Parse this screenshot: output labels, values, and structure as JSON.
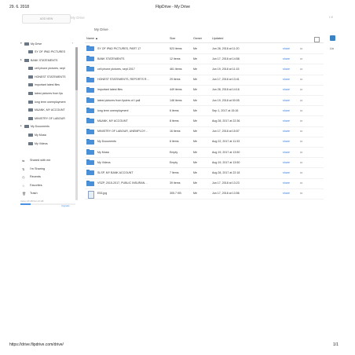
{
  "print_header": {
    "date": "29. 6. 2018",
    "title": "FlipDrive - My Drive"
  },
  "print_footer": {
    "url": "https://drive.flipdrive.com/drive/",
    "page": "1/1"
  },
  "topbar": {
    "new_label": "ADD NEW",
    "faint_title": "My Drive",
    "menu_faint": "Ⅱ  Ⅲ",
    "breadcrumb": "My Drive"
  },
  "right_partial": {
    "label": "Uo"
  },
  "sidebar": {
    "root": "My Drive",
    "items": [
      {
        "label": "SY OF IPAD PICTURES",
        "indent": 1
      },
      {
        "label": "BANK STATEMENTS",
        "indent": 0
      },
      {
        "label": "cell phone pictures, sept",
        "indent": 1
      },
      {
        "label": "HONEST STATEMENTS",
        "indent": 1
      },
      {
        "label": "important latest files",
        "indent": 1
      },
      {
        "label": "latest pictures from fys",
        "indent": 1
      },
      {
        "label": "long term unemployment",
        "indent": 1
      },
      {
        "label": "M&ANK, MY ACCOUNT",
        "indent": 1
      },
      {
        "label": "MINISTRY OF LABOUR",
        "indent": 1
      },
      {
        "label": "My Documents",
        "indent": 0
      },
      {
        "label": "My Music",
        "indent": 1
      },
      {
        "label": "My Videos",
        "indent": 1
      }
    ],
    "nav": [
      {
        "icon": "⇆",
        "label": "Shared with me"
      },
      {
        "icon": "⇅",
        "label": "I'm Sharing"
      },
      {
        "icon": "◷",
        "label": "Recents"
      },
      {
        "icon": "☆",
        "label": "Favorites"
      },
      {
        "icon": "🗑",
        "label": "Trash"
      }
    ],
    "usage_text": "Using 1.8 GB from 10 GB",
    "usage_fraction": 0.18,
    "upgrade_label": "Upgrade"
  },
  "table": {
    "headers": {
      "name": "Name ▲",
      "size": "Size",
      "owner": "Owner",
      "updated": "Updated"
    },
    "rows": [
      {
        "name": "SY OF IPAD PICTURES, PART 17",
        "size": "523 items",
        "owner": "Me",
        "updated": "Jun 28, 2018 at 11:20",
        "share": "share",
        "more": "•••"
      },
      {
        "name": "BANK STATEMENTS",
        "size": "12 items",
        "owner": "Me",
        "updated": "Jun 17, 2018 at 14:58",
        "share": "share",
        "more": "•••"
      },
      {
        "name": "cell phone pictures, sept 2017",
        "size": "461 items",
        "owner": "Me",
        "updated": "Jun 19, 2018 at 11:15",
        "share": "share",
        "more": "•••"
      },
      {
        "name": "HONEST STATEMENTS, REPORTS R…",
        "size": "29 items",
        "owner": "Me",
        "updated": "Jun 17, 2018 at 13:41",
        "share": "share",
        "more": "•••"
      },
      {
        "name": "important latest files",
        "size": "449 items",
        "owner": "Me",
        "updated": "Jun 28, 2018 at 14:16",
        "share": "share",
        "more": "•••"
      },
      {
        "name": "latest pictures from fysiers of I pall",
        "size": "146 items",
        "owner": "Me",
        "updated": "Jun 19, 2018 at 00:05",
        "share": "share",
        "more": "•••"
      },
      {
        "name": "long term unemployment",
        "size": "6 items",
        "owner": "Me",
        "updated": "Sep 1, 2017 at 15:16",
        "share": "share",
        "more": "•••"
      },
      {
        "name": "M&ANK, MY ACCOUNT",
        "size": "8 items",
        "owner": "Me",
        "updated": "Aug 28, 2017 at 22:36",
        "share": "share",
        "more": "•••"
      },
      {
        "name": "MINISTRY OF LABOUR, UNEMPLOY…",
        "size": "16 items",
        "owner": "Me",
        "updated": "Jun 17, 2018 at 15:57",
        "share": "share",
        "more": "•••"
      },
      {
        "name": "My Documents",
        "size": "6 items",
        "owner": "Me",
        "updated": "Aug 22, 2017 at 11:33",
        "share": "share",
        "more": "•••"
      },
      {
        "name": "My Music",
        "size": "Empty",
        "owner": "Me",
        "updated": "Aug 19, 2017 at 13:50",
        "share": "share",
        "more": "•••"
      },
      {
        "name": "My Videos",
        "size": "Empty",
        "owner": "Me",
        "updated": "Aug 19, 2017 at 13:50",
        "share": "share",
        "more": "•••"
      },
      {
        "name": "SLSP, MY BANK ACCOUNT",
        "size": "7 items",
        "owner": "Me",
        "updated": "Aug 28, 2017 at 22:18",
        "share": "share",
        "more": "•••"
      },
      {
        "name": "VSZP, 2015-2017, PUBLIC INSURAN…",
        "size": "39 items",
        "owner": "Me",
        "updated": "Jun 17, 2018 at 13:23",
        "share": "share",
        "more": "•••"
      },
      {
        "name": "E53.jpg",
        "size": "305.7 KB",
        "owner": "Me",
        "updated": "Jun 17, 2018 at 13:56",
        "share": "share",
        "more": "•••",
        "file": true
      }
    ]
  },
  "colors": {
    "folder": "#4a90d9",
    "link": "#3b7dd8",
    "accent": "#4a90e2"
  }
}
